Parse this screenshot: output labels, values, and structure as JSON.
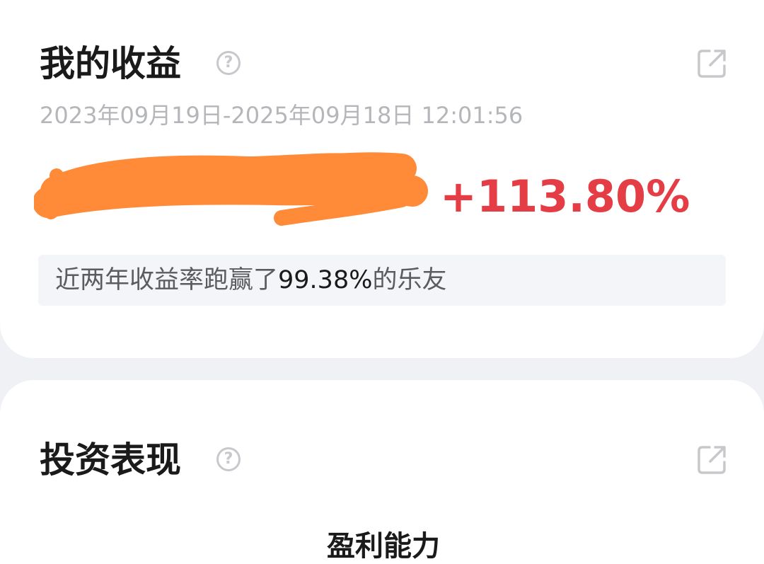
{
  "earnings_card": {
    "title": "我的收益",
    "help_icon": "question-circle-icon",
    "share_icon": "share-external-icon",
    "date_range": "2023年09月19日-2025年09月18日 12:01:56",
    "return_rate": "+113.80%",
    "rank_prefix": "近两年收益率跑赢了",
    "rank_percent": "99.38%",
    "rank_suffix": "的乐友",
    "colors": {
      "rate": "#e53d45",
      "scribble": "#ff8a38",
      "background": "#eff1f5"
    }
  },
  "performance_card": {
    "title": "投资表现",
    "help_icon": "question-circle-icon",
    "share_icon": "share-external-icon",
    "subtitle": "盈利能力"
  }
}
